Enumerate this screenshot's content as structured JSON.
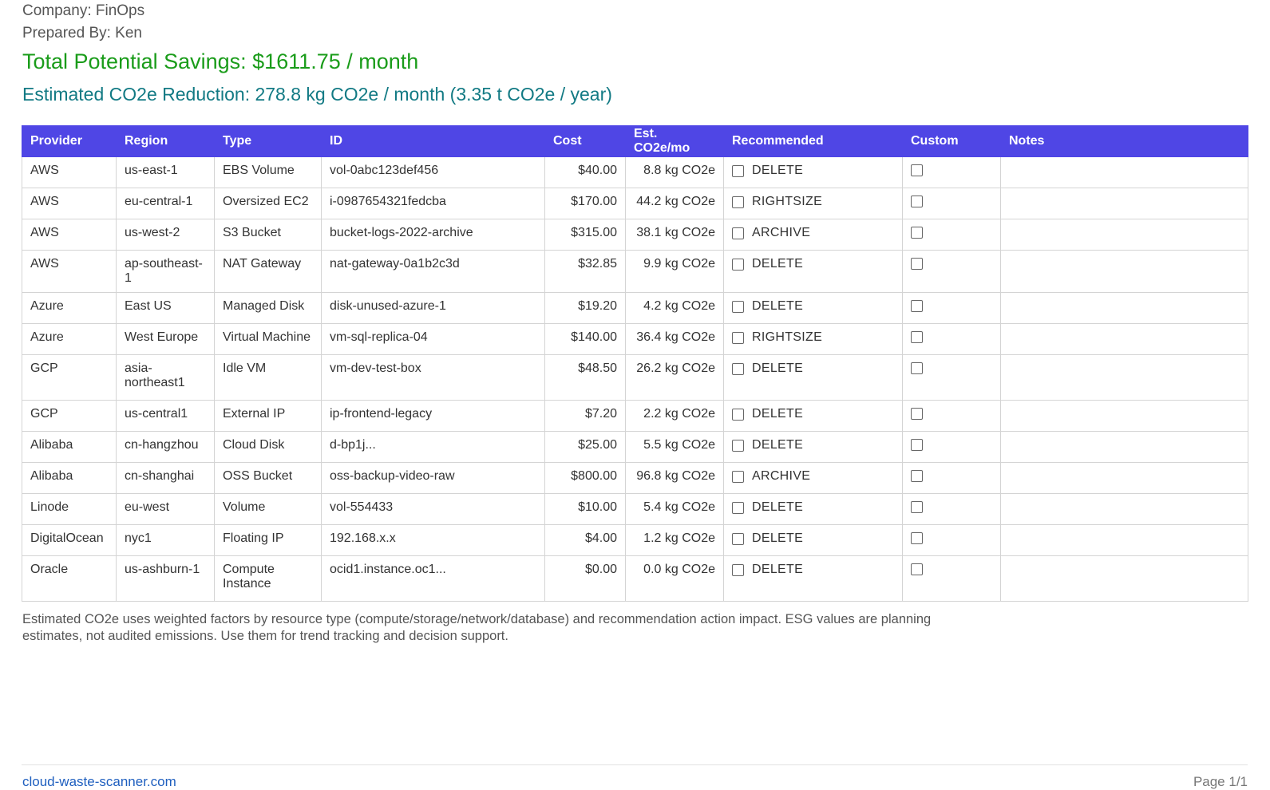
{
  "header": {
    "company": "Company: FinOps",
    "prepared_by": "Prepared By: Ken",
    "total_savings": "Total Potential Savings: $1611.75 / month",
    "co2_reduction": "Estimated CO2e Reduction: 278.8 kg CO2e / month (3.35 t CO2e / year)"
  },
  "table": {
    "columns": [
      "Provider",
      "Region",
      "Type",
      "ID",
      "Cost",
      "Est. CO2e/mo",
      "Recommended",
      "Custom",
      "Notes"
    ],
    "rows": [
      {
        "provider": "AWS",
        "region": "us-east-1",
        "type": "EBS Volume",
        "id": "vol-0abc123def456",
        "cost": "$40.00",
        "co2": "8.8 kg CO2e",
        "recommended": "DELETE",
        "notes": ""
      },
      {
        "provider": "AWS",
        "region": "eu-central-1",
        "type": "Oversized EC2",
        "id": "i-0987654321fedcba",
        "cost": "$170.00",
        "co2": "44.2 kg CO2e",
        "recommended": "RIGHTSIZE",
        "notes": ""
      },
      {
        "provider": "AWS",
        "region": "us-west-2",
        "type": "S3 Bucket",
        "id": "bucket-logs-2022-archive",
        "cost": "$315.00",
        "co2": "38.1 kg CO2e",
        "recommended": "ARCHIVE",
        "notes": ""
      },
      {
        "provider": "AWS",
        "region": "ap-southeast-1",
        "type": "NAT Gateway",
        "id": "nat-gateway-0a1b2c3d",
        "cost": "$32.85",
        "co2": "9.9 kg CO2e",
        "recommended": "DELETE",
        "notes": ""
      },
      {
        "provider": "Azure",
        "region": "East US",
        "type": "Managed Disk",
        "id": "disk-unused-azure-1",
        "cost": "$19.20",
        "co2": "4.2 kg CO2e",
        "recommended": "DELETE",
        "notes": ""
      },
      {
        "provider": "Azure",
        "region": "West Europe",
        "type": "Virtual Machine",
        "id": "vm-sql-replica-04",
        "cost": "$140.00",
        "co2": "36.4 kg CO2e",
        "recommended": "RIGHTSIZE",
        "notes": ""
      },
      {
        "provider": "GCP",
        "region": "asia-northeast1",
        "type": "Idle VM",
        "id": "vm-dev-test-box",
        "cost": "$48.50",
        "co2": "26.2 kg CO2e",
        "recommended": "DELETE",
        "notes": ""
      },
      {
        "provider": "GCP",
        "region": "us-central1",
        "type": "External IP",
        "id": "ip-frontend-legacy",
        "cost": "$7.20",
        "co2": "2.2 kg CO2e",
        "recommended": "DELETE",
        "notes": ""
      },
      {
        "provider": "Alibaba",
        "region": "cn-hangzhou",
        "type": "Cloud Disk",
        "id": "d-bp1j...",
        "cost": "$25.00",
        "co2": "5.5 kg CO2e",
        "recommended": "DELETE",
        "notes": ""
      },
      {
        "provider": "Alibaba",
        "region": "cn-shanghai",
        "type": "OSS Bucket",
        "id": "oss-backup-video-raw",
        "cost": "$800.00",
        "co2": "96.8 kg CO2e",
        "recommended": "ARCHIVE",
        "notes": ""
      },
      {
        "provider": "Linode",
        "region": "eu-west",
        "type": "Volume",
        "id": "vol-554433",
        "cost": "$10.00",
        "co2": "5.4 kg CO2e",
        "recommended": "DELETE",
        "notes": ""
      },
      {
        "provider": "DigitalOcean",
        "region": "nyc1",
        "type": "Floating IP",
        "id": "192.168.x.x",
        "cost": "$4.00",
        "co2": "1.2 kg CO2e",
        "recommended": "DELETE",
        "notes": ""
      },
      {
        "provider": "Oracle",
        "region": "us-ashburn-1",
        "type": "Compute Instance",
        "id": "ocid1.instance.oc1...",
        "cost": "$0.00",
        "co2": "0.0 kg CO2e",
        "recommended": "DELETE",
        "notes": ""
      }
    ]
  },
  "disclaimer": "Estimated CO2e uses weighted factors by resource type (compute/storage/network/database) and recommendation action impact. ESG values are planning estimates, not audited emissions. Use them for trend tracking and decision support.",
  "footer": {
    "link": "cloud-waste-scanner.com",
    "page": "Page 1/1"
  },
  "colors": {
    "header_bg": "#4f46e5",
    "savings_green": "#1a9c1a",
    "co2_teal": "#127a84",
    "link_blue": "#1f5fbf"
  }
}
